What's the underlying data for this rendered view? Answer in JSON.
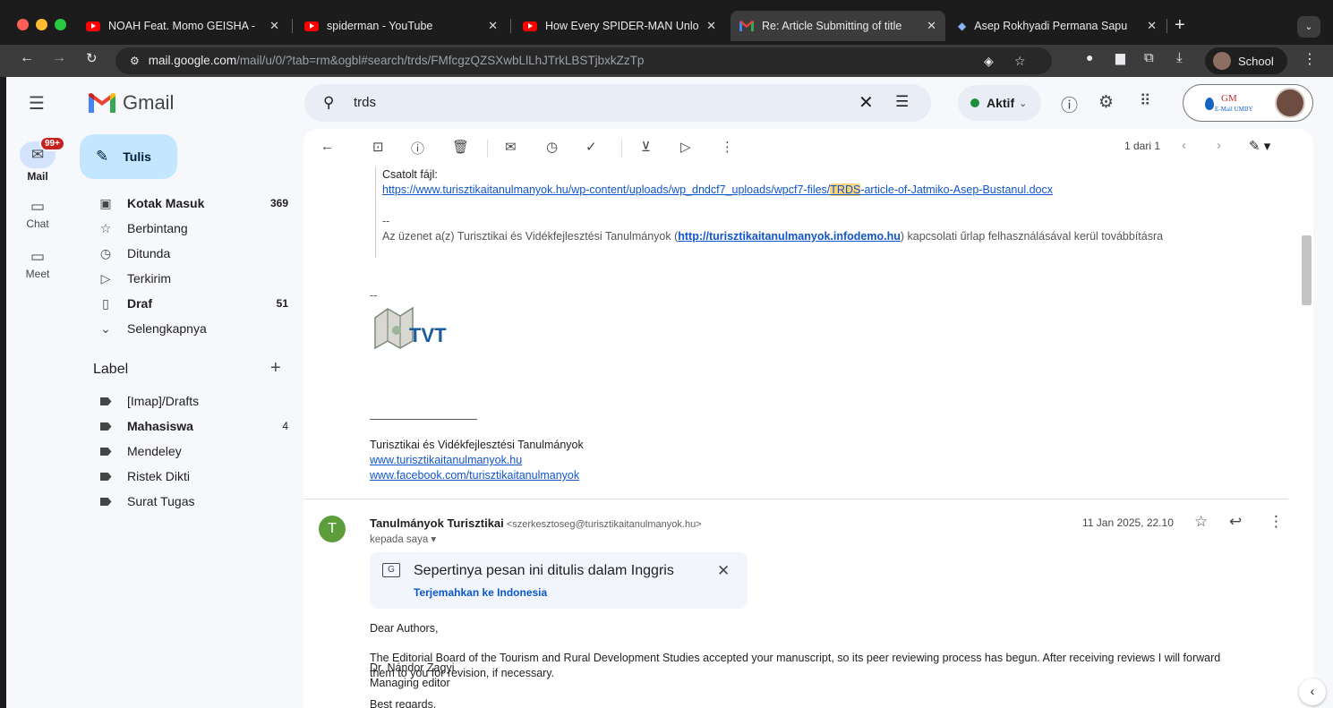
{
  "browser": {
    "tabs": [
      {
        "title": "NOAH Feat. Momo GEISHA - ",
        "favicon": "youtube-icon"
      },
      {
        "title": "spiderman - YouTube",
        "favicon": "youtube-icon"
      },
      {
        "title": "How Every SPIDER-MAN Unlo",
        "favicon": "youtube-icon"
      },
      {
        "title": "Re: Article Submitting of title",
        "favicon": "gmail-icon",
        "active": true
      },
      {
        "title": "Asep Rokhyadi Permana Sapu",
        "favicon": "graduation-cap-icon"
      }
    ],
    "url_host": "mail.google.com",
    "url_path": "/mail/u/0/?tab=rm&ogbl#search/trds/FMfcgzQZSXwbLlLhJTrkLBSTjbxkZzTp",
    "profile_label": "School"
  },
  "gmail": {
    "logo_text": "Gmail",
    "search_value": "trds",
    "status_label": "Aktif",
    "status_color": "#1e8e3e",
    "account": {
      "org_mark": "GM",
      "org_sub": "E-Mail UMBY"
    },
    "rail": {
      "mail": "Mail",
      "mail_badge": "99+",
      "chat": "Chat",
      "meet": "Meet"
    },
    "compose_label": "Tulis",
    "nav": [
      {
        "label": "Kotak Masuk",
        "count": "369",
        "icon": "inbox-icon",
        "bold": true
      },
      {
        "label": "Berbintang",
        "count": "",
        "icon": "star-icon"
      },
      {
        "label": "Ditunda",
        "count": "",
        "icon": "clock-icon"
      },
      {
        "label": "Terkirim",
        "count": "",
        "icon": "send-icon"
      },
      {
        "label": "Draf",
        "count": "51",
        "icon": "draft-icon",
        "bold": true
      },
      {
        "label": "Selengkapnya",
        "count": "",
        "icon": "chevron-down-icon"
      }
    ],
    "labels_header": "Label",
    "labels": [
      {
        "label": "[Imap]/Drafts",
        "count": ""
      },
      {
        "label": "Mahasiswa",
        "count": "4",
        "bold": true
      },
      {
        "label": "Mendeley",
        "count": ""
      },
      {
        "label": "Ristek Dikti",
        "count": ""
      },
      {
        "label": "Surat Tugas",
        "count": ""
      }
    ],
    "message": {
      "pagination": "1 dari 1",
      "quoted": {
        "attachment_label": "Csatolt fájl:",
        "attachment_link_pre": "https://www.turisztikaitanulmanyok.hu/wp-content/uploads/wp_dndcf7_uploads/wpcf7-files/",
        "attachment_link_hl": "TRDS",
        "attachment_link_post": "-article-of-Jatmiko-Asep-Bustanul.docx",
        "sig_dash": "--",
        "notice_pre": "Az üzenet a(z) Turisztikai és Vidékfejlesztési Tanulmányok (",
        "notice_link": "http://turisztikaitanulmanyok.infodemo.hu",
        "notice_post": ") kapcsolati űrlap felhasználásával kerül továbbításra"
      },
      "signature": {
        "dash": "--",
        "logo_text": "TVT",
        "org_name": "Turisztikai és Vidékfejlesztési Tanulmányok",
        "website": "www.turisztikaitanulmanyok.hu",
        "facebook": "www.facebook.com/turisztikaitanulmanyok"
      },
      "sender": {
        "initial": "T",
        "name": "Tanulmányok Turisztikai",
        "email": "<szerkesztoseg@turisztikaitanulmanyok.hu>",
        "recipients": "kepada saya",
        "date": "11 Jan 2025, 22.10"
      },
      "translate": {
        "title": "Sepertinya pesan ini ditulis dalam Inggris",
        "link": "Terjemahkan ke Indonesia"
      },
      "body": {
        "greeting": "Dear Authors,",
        "para_line1": "The Editorial Board of the Tourism and Rural Development Studies accepted your manuscript, so its peer reviewing process has begun. After receiving reviews I will forward",
        "para_line2": "them to you for revision, if necessary.",
        "closing": "Best regards,",
        "signer": "Dr. Nándor Zagyi",
        "role": "Managing editor"
      }
    }
  }
}
